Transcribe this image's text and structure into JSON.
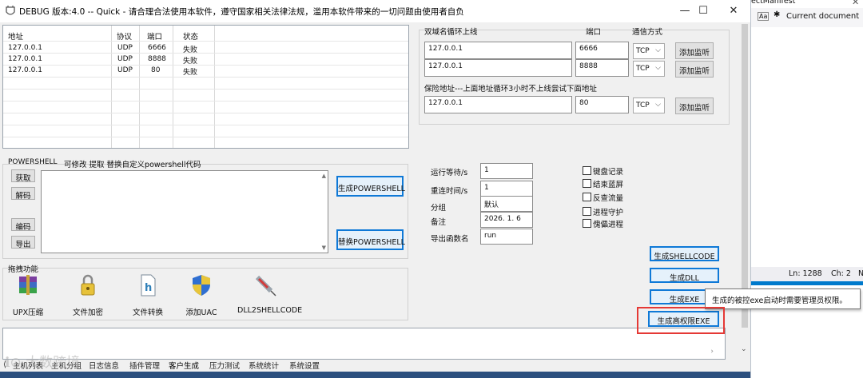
{
  "window": {
    "title": "DEBUG 版本:4.0   -- Quick - 请合理合法使用本软件，遵守国家相关法律法规，滥用本软件带来的一切问题由使用者自负",
    "minimize": "—",
    "maximize": "☐",
    "close": "✕"
  },
  "host_list": {
    "columns": [
      "地址",
      "协议",
      "端口",
      "状态"
    ],
    "rows": [
      [
        "127.0.0.1",
        "UDP",
        "6666",
        "失败"
      ],
      [
        "127.0.0.1",
        "UDP",
        "8888",
        "失败"
      ],
      [
        "127.0.0.1",
        "UDP",
        "80",
        "失败"
      ]
    ]
  },
  "domain": {
    "label": "双域名循环上线",
    "port_label": "端口",
    "mode_label": "通信方式",
    "rows": [
      {
        "host": "127.0.0.1",
        "port": "6666",
        "proto": "TCP",
        "button": "添加监听"
      },
      {
        "host": "127.0.0.1",
        "port": "8888",
        "proto": "TCP",
        "button": "添加监听"
      }
    ],
    "fallback_label": "保险地址---上面地址循环3小时不上线尝试下面地址",
    "fallback": {
      "host": "127.0.0.1",
      "port": "80",
      "proto": "TCP",
      "button": "添加监听"
    }
  },
  "powershell": {
    "title": "POWERSHELL",
    "hint": "可修改  提取 替换自定义powershell代码",
    "btn_get": "获取",
    "btn_decode": "解码",
    "btn_encode": "编码",
    "btn_export": "导出",
    "btn_generate": "生成POWERSHELL",
    "btn_replace": "替换POWERSHELL"
  },
  "settings": {
    "run_wait_label": "运行等待/s",
    "run_wait": "1",
    "reconnect_label": "重连时间/s",
    "reconnect": "1",
    "group_label": "分组",
    "group": "默认",
    "note_label": "备注",
    "note": "2026. 1. 6",
    "export_label": "导出函数名",
    "export": "run"
  },
  "checkboxes": [
    "键盘记录",
    "结束蓝屏",
    "反查流量",
    "进程守护",
    "傀儡进程"
  ],
  "drag": {
    "title": "拖拽功能",
    "tools": [
      "UPX压缩",
      "文件加密",
      "文件转换",
      "添加UAC",
      "DLL2SHELLCODE"
    ]
  },
  "generate": {
    "shellcode": "生成SHELLCODE",
    "dll": "生成DLL",
    "exe": "生成EXE",
    "admin_exe": "生成高权限EXE"
  },
  "tooltip": "生成的被控exe启动时需要管理员权限。",
  "tabs": [
    "主机列表",
    "主机分组",
    "日志信息",
    "插件管理",
    "客户生成",
    "压力测试",
    "系统统计",
    "系统设置"
  ],
  "active_tab": "客户生成",
  "watermark": "大数跨境",
  "ide": {
    "file_fragment": "ectManifest",
    "scope_label": "Current document",
    "line": "Ln: 1288",
    "col": "Ch: 2",
    "extra": "N"
  },
  "colors": {
    "accent": "#0f79d7",
    "highlight": "#e53935",
    "tab_strip": "#2b4f7e"
  }
}
